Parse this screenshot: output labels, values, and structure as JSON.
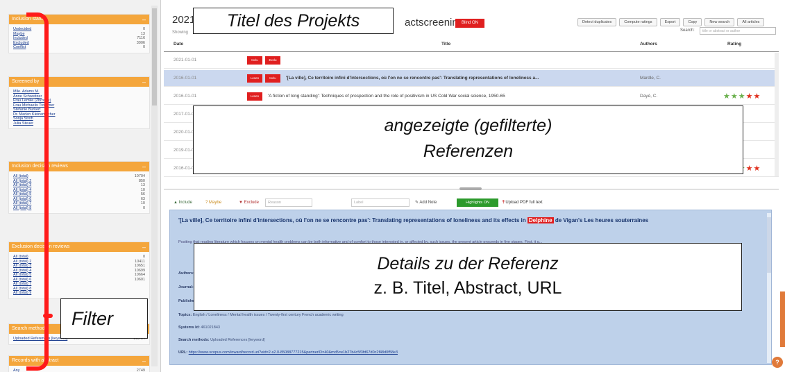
{
  "annotations": {
    "titel": "Titel des Projekts",
    "referenzen_line1": "angezeigte (gefilterte)",
    "referenzen_line2": "Referenzen",
    "details_line1": "Details zu der Referenz",
    "details_line2": "z. B. Titel, Abstract, URL",
    "filter": "Filter",
    "bracket_color": "#ff1a1a"
  },
  "project": {
    "title_prefix": "2021",
    "title_suffix": "actscreening",
    "badge": "Blind ON",
    "showing": "Showing"
  },
  "toolbar": {
    "buttons": [
      "Detect duplicates",
      "Compute ratings",
      "Export",
      "Copy",
      "New search",
      "All articles"
    ],
    "search_label": "Search:",
    "search_placeholder": "title or abstract or author"
  },
  "table": {
    "headers": {
      "date": "Date",
      "title": "Title",
      "authors": "Authors",
      "rating": "Rating"
    },
    "rows": [
      {
        "date": "2021-01-01",
        "tags": [
          "Inclu",
          "Exclu"
        ],
        "title": "",
        "authors": "",
        "rating": 0
      },
      {
        "date": "2016-01-01",
        "tags": [
          "Lesen",
          "Inclu"
        ],
        "title": "'[La ville], Ce territoire infini d'intersections, où l'on ne se rencontre pas':  Translating representations of loneliness a...",
        "authors": "Mardle, C.",
        "rating": 0,
        "selected": true
      },
      {
        "date": "2016-01-01",
        "tags": [
          "Lesen"
        ],
        "title": "'A fiction of long standing': Techniques of prospection and the role of positivism in US Cold War social science, 1950-65",
        "authors": "Dayé, C.",
        "rating": 3
      },
      {
        "date": "2017-01-01",
        "tags": [],
        "title": "",
        "authors": "",
        "rating": 0
      },
      {
        "date": "2020-01-01",
        "tags": [],
        "title": "",
        "authors": "",
        "rating": 0
      },
      {
        "date": "2019-01-01",
        "tags": [],
        "title": "",
        "authors": "",
        "rating": 0
      },
      {
        "date": "2016-01-01",
        "tags": [],
        "title": "",
        "authors": "",
        "rating": 3
      }
    ]
  },
  "sidebar": {
    "panels": [
      {
        "header": "Inclusion status",
        "rows": [
          [
            "Undecided",
            "0"
          ],
          [
            "Maybe",
            "13"
          ],
          [
            "Included",
            "7116"
          ],
          [
            "Excluded",
            "3006"
          ],
          [
            "Conflict",
            "0"
          ]
        ]
      },
      {
        "header": "Screened by",
        "rows": [
          [
            "Mlle. Adams M.",
            ""
          ],
          [
            "Anne Schweitzer",
            ""
          ],
          [
            "Frau Lemke (Zbrosek)",
            ""
          ],
          [
            "Frau Michaelis Trommer",
            ""
          ],
          [
            "Stefanie Burkert",
            ""
          ],
          [
            "Dr. Marlen Kleinemacher",
            ""
          ],
          [
            "Sonja Stroh",
            ""
          ],
          [
            "Julia Steuer",
            ""
          ]
        ]
      },
      {
        "header": "Inclusion decision reviews",
        "rows": [
          [
            "All (total)",
            "10704"
          ],
          [
            "All (total) 2",
            "850"
          ],
          [
            "All (total) 3",
            "13"
          ],
          [
            "All (total) 4",
            "10"
          ],
          [
            "All (total) 5",
            "56"
          ],
          [
            "All (total) 6",
            "63"
          ],
          [
            "All (total) 7",
            "10"
          ],
          [
            "All (total) 8",
            "0"
          ]
        ]
      },
      {
        "header": "Exclusion decision reviews",
        "rows": [
          [
            "All (total)",
            "0"
          ],
          [
            "All (total) 2",
            "10411"
          ],
          [
            "All (total) 3",
            "10651"
          ],
          [
            "All (total) 4",
            "10699"
          ],
          [
            "All (total) 5",
            "10664"
          ],
          [
            "All (total) 6",
            "10601"
          ],
          [
            "All (total) 7",
            ""
          ],
          [
            "All (total) 8",
            ""
          ],
          [
            "All (total) 9",
            ""
          ]
        ]
      },
      {
        "header": "Search methods",
        "rows": [
          [
            "Uploaded References [keyword]",
            "10,704"
          ]
        ]
      },
      {
        "header": "Records with abstract",
        "rows": [
          [
            "Any",
            "2749"
          ]
        ]
      }
    ]
  },
  "detail_toolbar": {
    "include": "Include",
    "maybe": "Maybe",
    "exclude": "Exclude",
    "reason_placeholder": "Reason",
    "label_placeholder": "Label",
    "add_note": "Add Note",
    "highlights": "Highlights ON",
    "upload_pdf": "Upload PDF full text"
  },
  "detail": {
    "title_before": "'[La ville], Ce territoire infini d'intersections, où l'on ne se rencontre pas': Translating representations of loneliness and its effects in ",
    "title_highlight": "Delphine",
    "title_after": " de Vigan's Les heures souterraines",
    "abstract": "Positing that reading literature which focuses on mental health problems can be both informative and of comfort to those interested in, or affected by, such issues, the present article proceeds in five stages. First, it g...",
    "fields": [
      {
        "label": "Authors:",
        "value": ""
      },
      {
        "label": "Journal:",
        "value": ""
      },
      {
        "label": "Publisher:",
        "value": ""
      },
      {
        "label": "Topics:",
        "value": "English / Loneliness / Mental health issues / Twenty-first century French academic writing"
      },
      {
        "label": "Systems Id:",
        "value": "461021843"
      },
      {
        "label": "Search methods:",
        "value": "Uploaded References [keyword]"
      },
      {
        "label": "URL:",
        "value": "https://www.scopus.com/inward/record.uri?eid=2-s2.0-85088777215&partnerID=40&md5=e1b27b4c5f3fd67d0c2f48d0f58e3"
      }
    ]
  },
  "help": "?"
}
